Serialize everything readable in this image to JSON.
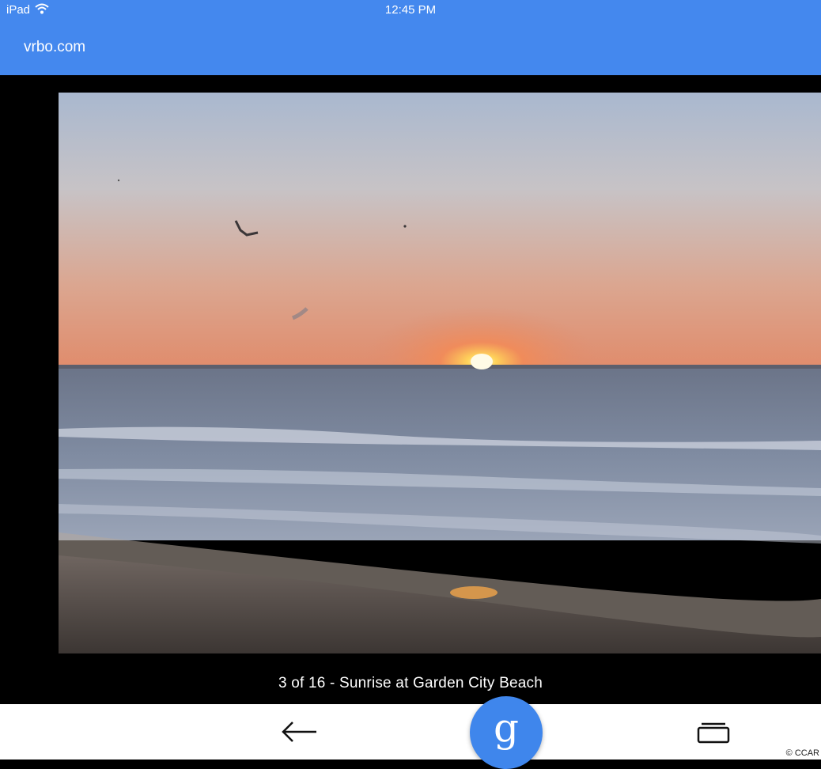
{
  "status_bar": {
    "device": "iPad",
    "time": "12:45 PM"
  },
  "browser": {
    "url": "vrbo.com"
  },
  "gallery": {
    "caption": "3 of 16 - Sunrise at Garden City Beach"
  },
  "toolbar": {
    "google_glyph": "g"
  },
  "footer": {
    "copyright": "© CCAR"
  },
  "colors": {
    "bar_blue": "#4488ee",
    "google_blue": "#3f86ec"
  },
  "icons": [
    "wifi-icon",
    "back-arrow-icon",
    "google-icon",
    "tabs-icon"
  ]
}
